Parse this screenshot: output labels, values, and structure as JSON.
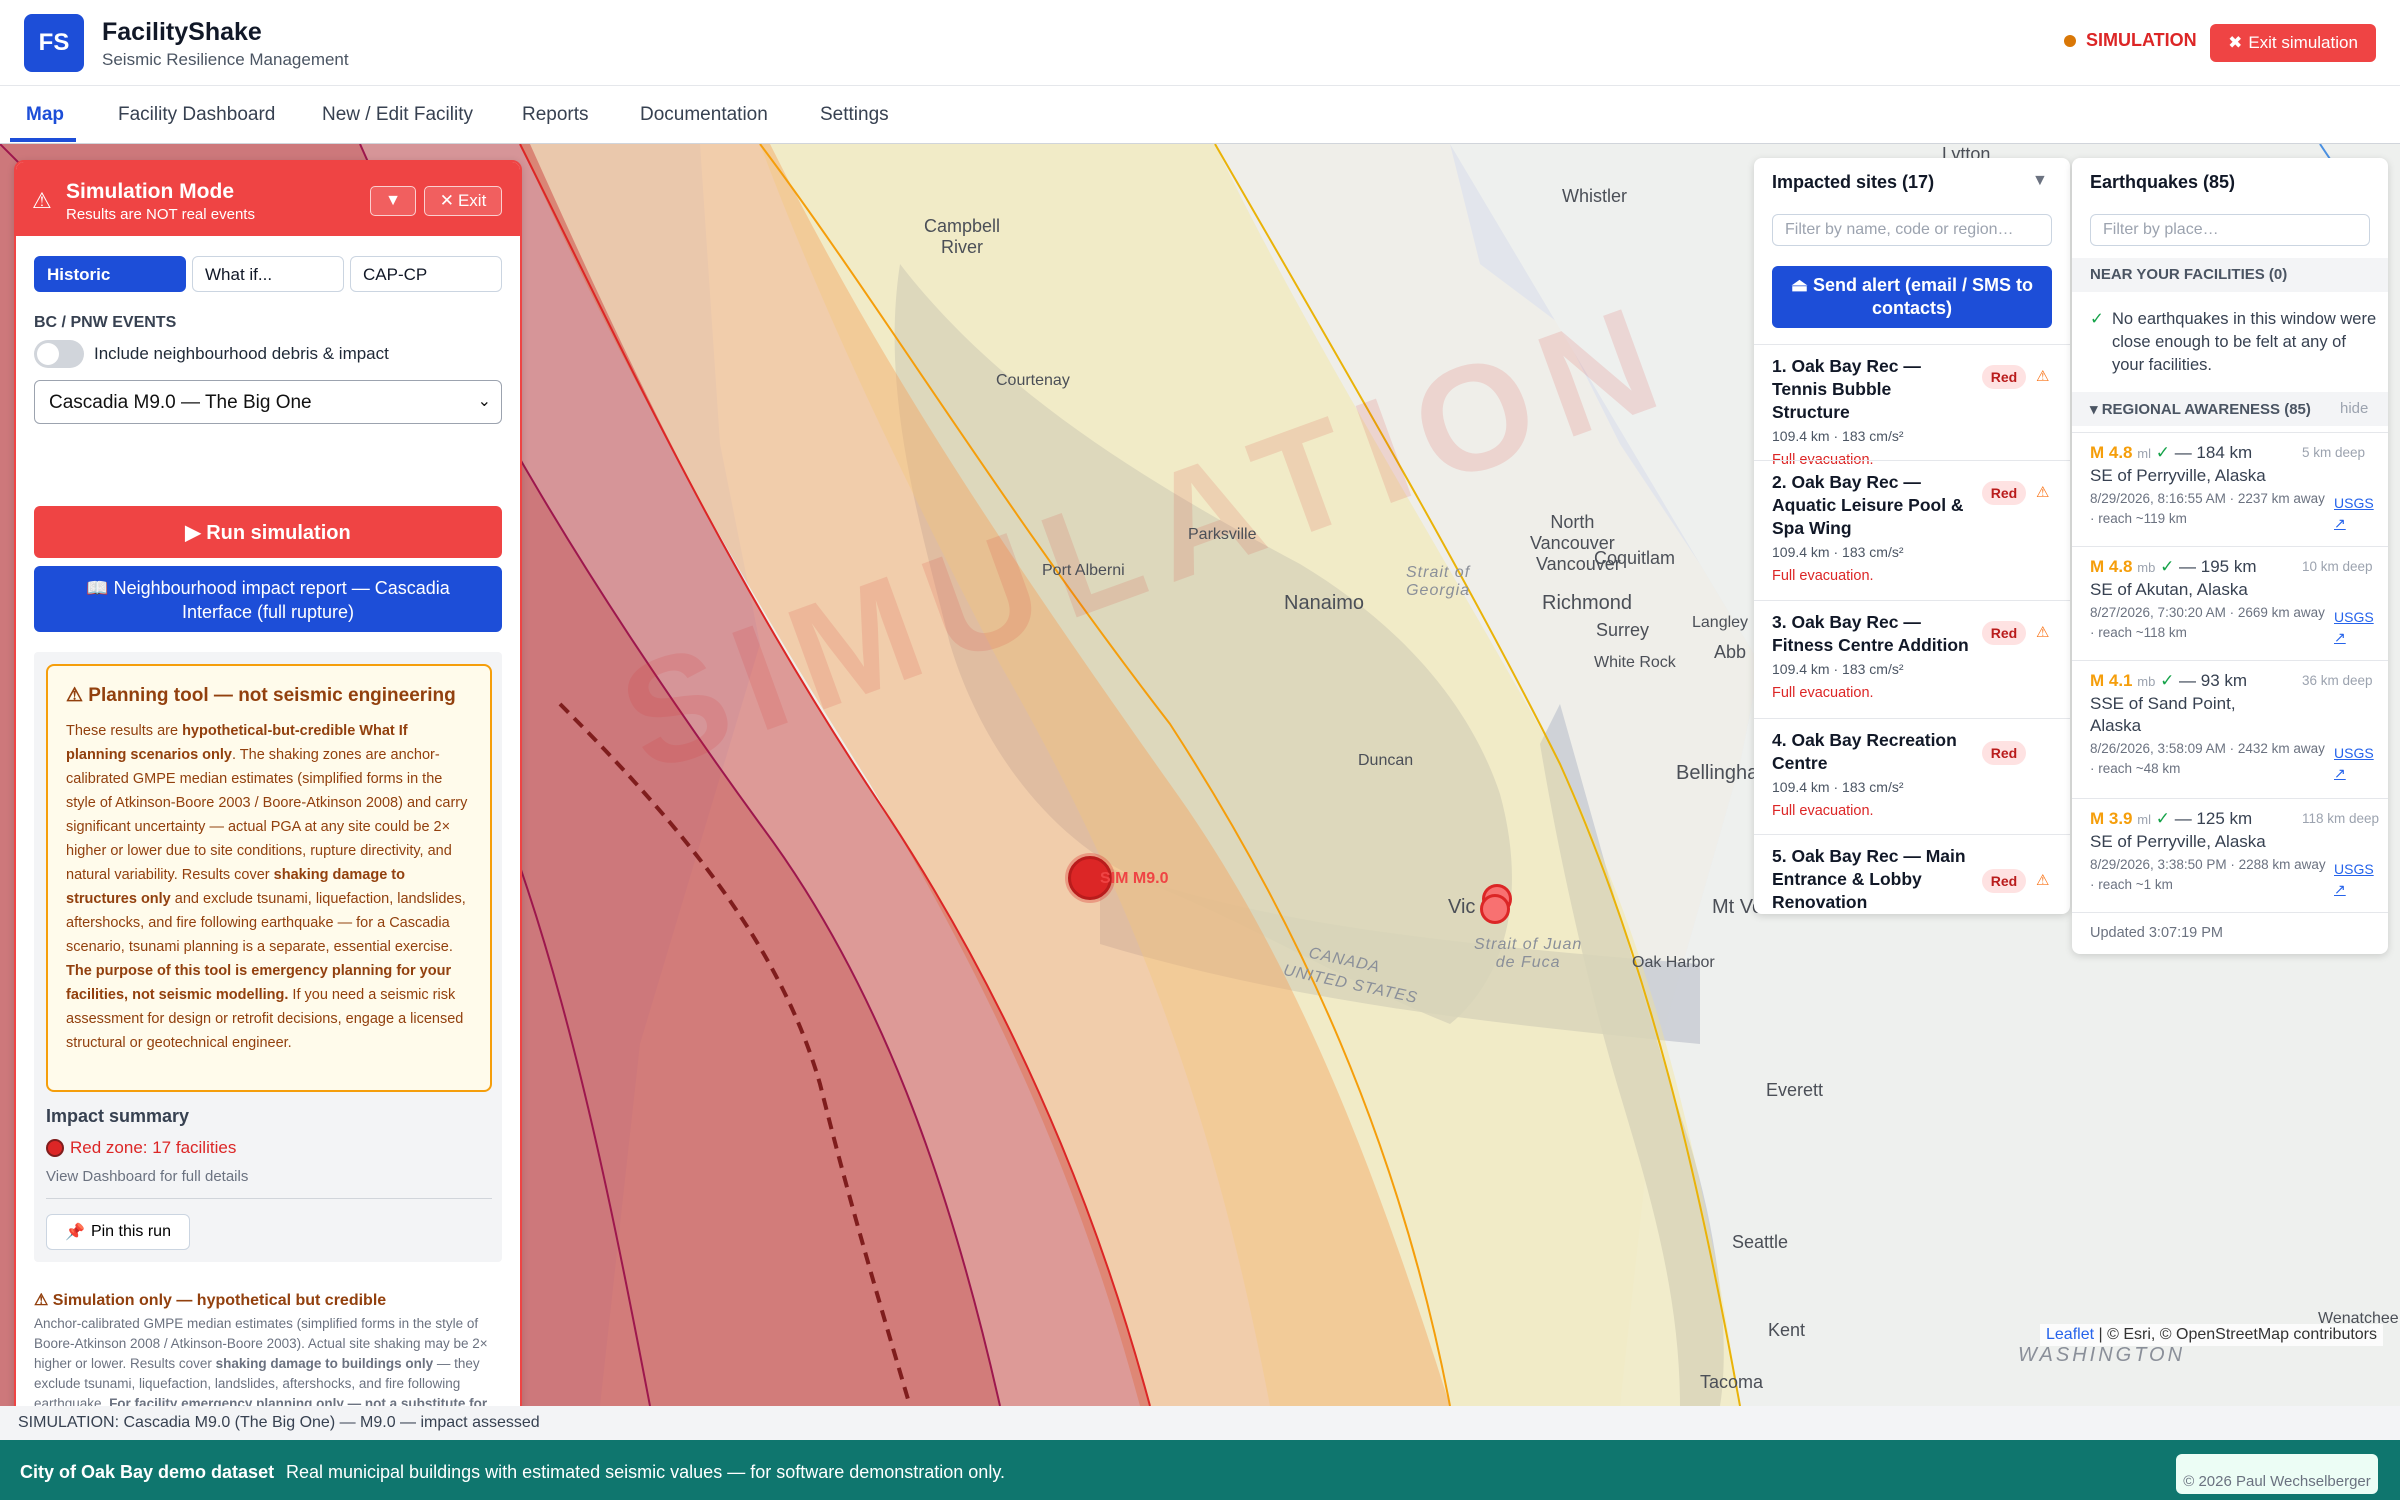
{
  "header": {
    "logo": "FS",
    "title": "FacilityShake",
    "subtitle": "Seismic Resilience Management",
    "sim_indicator": "SIMULATION",
    "exit_button": "Exit simulation"
  },
  "nav": {
    "tabs": [
      {
        "label": "Map",
        "active": true
      },
      {
        "label": "Facility Dashboard"
      },
      {
        "label": "New / Edit Facility"
      },
      {
        "label": "Reports"
      },
      {
        "label": "Documentation"
      },
      {
        "label": "Settings"
      }
    ]
  },
  "map": {
    "watermark": "SIMULATION",
    "epicenter_label": "SIM M9.0",
    "labels": {
      "lytton": "Lytton",
      "whistler": "Whistler",
      "campbell_river": "Campbell\nRiver",
      "courtenay": "Courtenay",
      "parksville": "Parksville",
      "port_alberni": "Port Alberni",
      "nanaimo": "Nanaimo",
      "strait_georgia": "Strait of\nGeorgia",
      "north_vancouver": "North\nVancouver",
      "vancouver": "Vancouver",
      "coquitlam": "Coquitlam",
      "richmond": "Richmond",
      "surrey": "Surrey",
      "langley": "Langley",
      "white_rock": "White Rock",
      "abbotsford": "Abb",
      "bellingham": "Bellingha",
      "duncan": "Duncan",
      "victoria": "Vic",
      "strait_juan": "Strait of Juan\nde Fuca",
      "canada": "CANADA",
      "united_states": "UNITED STATES",
      "mt_vernon": "Mt Ve",
      "oak_harbor": "Oak Harbor",
      "everett": "Everett",
      "seattle": "Seattle",
      "kent": "Kent",
      "tacoma": "Tacoma",
      "washington": "WASHINGTON",
      "wenatchee": "Wenatchee"
    },
    "zoom_in": "+",
    "zoom_out": "−",
    "attribution_leaflet": "Leaflet",
    "attribution_rest": "| © Esri, © OpenStreetMap contributors",
    "zone_colors": {
      "red": "#c83232",
      "orange": "#f59e0b",
      "yellow": "#fde68a"
    }
  },
  "sim_panel": {
    "title": "Simulation Mode",
    "subtitle": "Results are NOT real events",
    "collapse": "▼",
    "exit": "Exit",
    "modes": [
      "Historic",
      "What if...",
      "CAP-CP"
    ],
    "events_heading": "BC / PNW EVENTS",
    "toggle_label": "Include neighbourhood debris & impact",
    "scenario": "Cascadia M9.0 — The Big One",
    "run_button": "▶ Run simulation",
    "report_button": "Neighbourhood impact report — Cascadia Interface (full rupture)",
    "planning_title": "⚠ Planning tool — not seismic engineering",
    "planning_p1": "These results are ",
    "planning_b1": "hypothetical-but-credible What If planning scenarios only",
    "planning_p2": ". The shaking zones are anchor-calibrated GMPE median estimates (simplified forms in the style of Atkinson-Boore 2003 / Boore-Atkinson 2008) and carry significant uncertainty — actual PGA at any site could be 2× higher or lower due to site conditions, rupture directivity, and natural variability. Results cover ",
    "planning_b2": "shaking damage to structures only",
    "planning_p3": " and exclude tsunami, liquefaction, landslides, aftershocks, and fire following earthquake — for a Cascadia scenario, tsunami planning is a separate, essential exercise. ",
    "planning_b3": "The purpose of this tool is emergency planning for your facilities, not seismic modelling.",
    "planning_p4": " If you need a seismic risk assessment for design or retrofit decisions, engage a licensed structural or geotechnical engineer.",
    "impact_title": "Impact summary",
    "red_zone": "Red zone: 17 facilities",
    "dashboard_link": "View Dashboard for full details",
    "pin_button": "Pin this run",
    "footer_title": "⚠ Simulation only — hypothetical but credible",
    "footer_p1": "Anchor-calibrated GMPE median estimates (simplified forms in the style of Boore-Atkinson 2008 / Atkinson-Boore 2003). Actual site shaking may be 2× higher or lower. Results cover ",
    "footer_b1": "shaking damage to buildings only",
    "footer_p2": " — they exclude tsunami, liquefaction, landslides, aftershocks, and fire following earthquake. ",
    "footer_b2": "For facility emergency planning only — not a substitute for"
  },
  "impacted": {
    "title": "Impacted sites (17)",
    "filter_placeholder": "Filter by name, code or region…",
    "alert_button": "Send alert (email / SMS to contacts)",
    "sites": [
      {
        "name": "1. Oak Bay Rec — Tennis Bubble Structure",
        "meta": "109.4 km · 183 cm/s²",
        "evac": "Full evacuation.",
        "badge": "Red"
      },
      {
        "name": "2. Oak Bay Rec — Aquatic Leisure Pool & Spa Wing",
        "meta": "109.4 km · 183 cm/s²",
        "evac": "Full evacuation.",
        "badge": "Red"
      },
      {
        "name": "3. Oak Bay Rec — Fitness Centre Addition",
        "meta": "109.4 km · 183 cm/s²",
        "evac": "Full evacuation.",
        "badge": "Red"
      },
      {
        "name": "4. Oak Bay Recreation Centre",
        "meta": "109.4 km · 183 cm/s²",
        "evac": "Full evacuation.",
        "badge": "Red"
      },
      {
        "name": "5. Oak Bay Rec — Main Entrance & Lobby Renovation",
        "meta": "",
        "evac": "",
        "badge": "Red"
      }
    ]
  },
  "earthquakes": {
    "title": "Earthquakes (85)",
    "filter_placeholder": "Filter by place…",
    "near_heading": "NEAR YOUR FACILITIES (0)",
    "near_message": "No earthquakes in this window were close enough to be felt at any of your facilities.",
    "regional_heading": "▾ REGIONAL AWARENESS (85)",
    "hide": "hide",
    "items": [
      {
        "mag": "M 4.8",
        "type": "ml",
        "dist": "— 184 km",
        "depth": "5 km deep",
        "place": "SE of Perryville, Alaska",
        "meta": "8/29/2026, 8:16:55 AM · 2237 km away · reach ~119 km",
        "link": "USGS ↗"
      },
      {
        "mag": "M 4.8",
        "type": "mb",
        "dist": "— 195 km",
        "depth": "10 km deep",
        "place": "SE of Akutan, Alaska",
        "meta": "8/27/2026, 7:30:20 AM · 2669 km away · reach ~118 km",
        "link": "USGS ↗"
      },
      {
        "mag": "M 4.1",
        "type": "mb",
        "dist": "— 93 km",
        "depth": "36 km deep",
        "place": "SSE of Sand Point, Alaska",
        "meta": "8/26/2026, 3:58:09 AM · 2432 km away · reach ~48 km",
        "link": "USGS ↗"
      },
      {
        "mag": "M 3.9",
        "type": "ml",
        "dist": "— 125 km",
        "depth": "118 km deep",
        "place": "SE of Perryville, Alaska",
        "meta": "8/29/2026, 3:38:50 PM · 2288 km away · reach ~1 km",
        "link": "USGS ↗"
      }
    ],
    "updated": "Updated 3:07:19 PM"
  },
  "status": "SIMULATION: Cascadia M9.0 (The Big One) — M9.0 — impact assessed",
  "footer": {
    "title": "City of Oak Bay demo dataset",
    "text": "Real municipal buildings with estimated seismic values — for software demonstration only.",
    "copyright": "© 2026 Paul Wechselberger"
  }
}
